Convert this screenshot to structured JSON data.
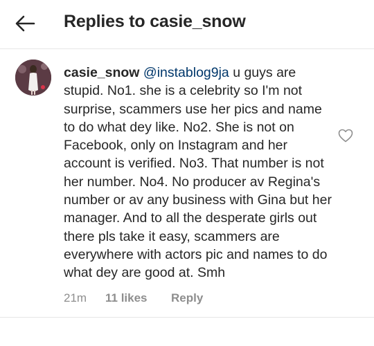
{
  "header": {
    "title": "Replies to casie_snow",
    "back_icon": "arrow-left-icon"
  },
  "comment": {
    "username": "casie_snow",
    "mention": "@instablog9ja",
    "text": "u guys are stupid. No1. she is a celebrity so I'm not surprise, scammers use her pics and name to do what dey like. No2. She is not on Facebook, only on Instagram and her account is verified. No3. That number is not her number. No4. No producer av Regina's number or av any business with Gina but her manager. And to all the desperate girls out there pls take it easy, scammers are everywhere with actors pic and names to do what dey are good at. Smh",
    "time": "21m",
    "likes": "11 likes",
    "reply_label": "Reply",
    "like_icon": "heart-outline-icon"
  },
  "colors": {
    "text": "#262626",
    "mention": "#00376b",
    "meta": "#8e8e8e",
    "divider": "#e6e6e6"
  }
}
